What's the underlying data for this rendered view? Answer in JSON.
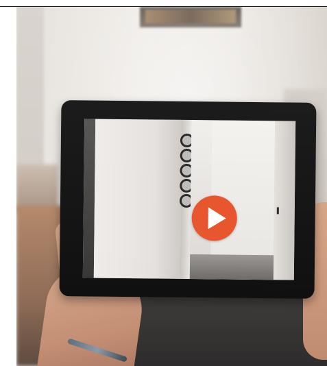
{
  "video_thumbnail": {
    "play_button": {
      "icon": "play-icon",
      "color": "#e8562f",
      "icon_color": "#ffffff"
    }
  },
  "colors": {
    "tablet_bezel": "#151516",
    "background_wall": "#e9e5e0"
  }
}
